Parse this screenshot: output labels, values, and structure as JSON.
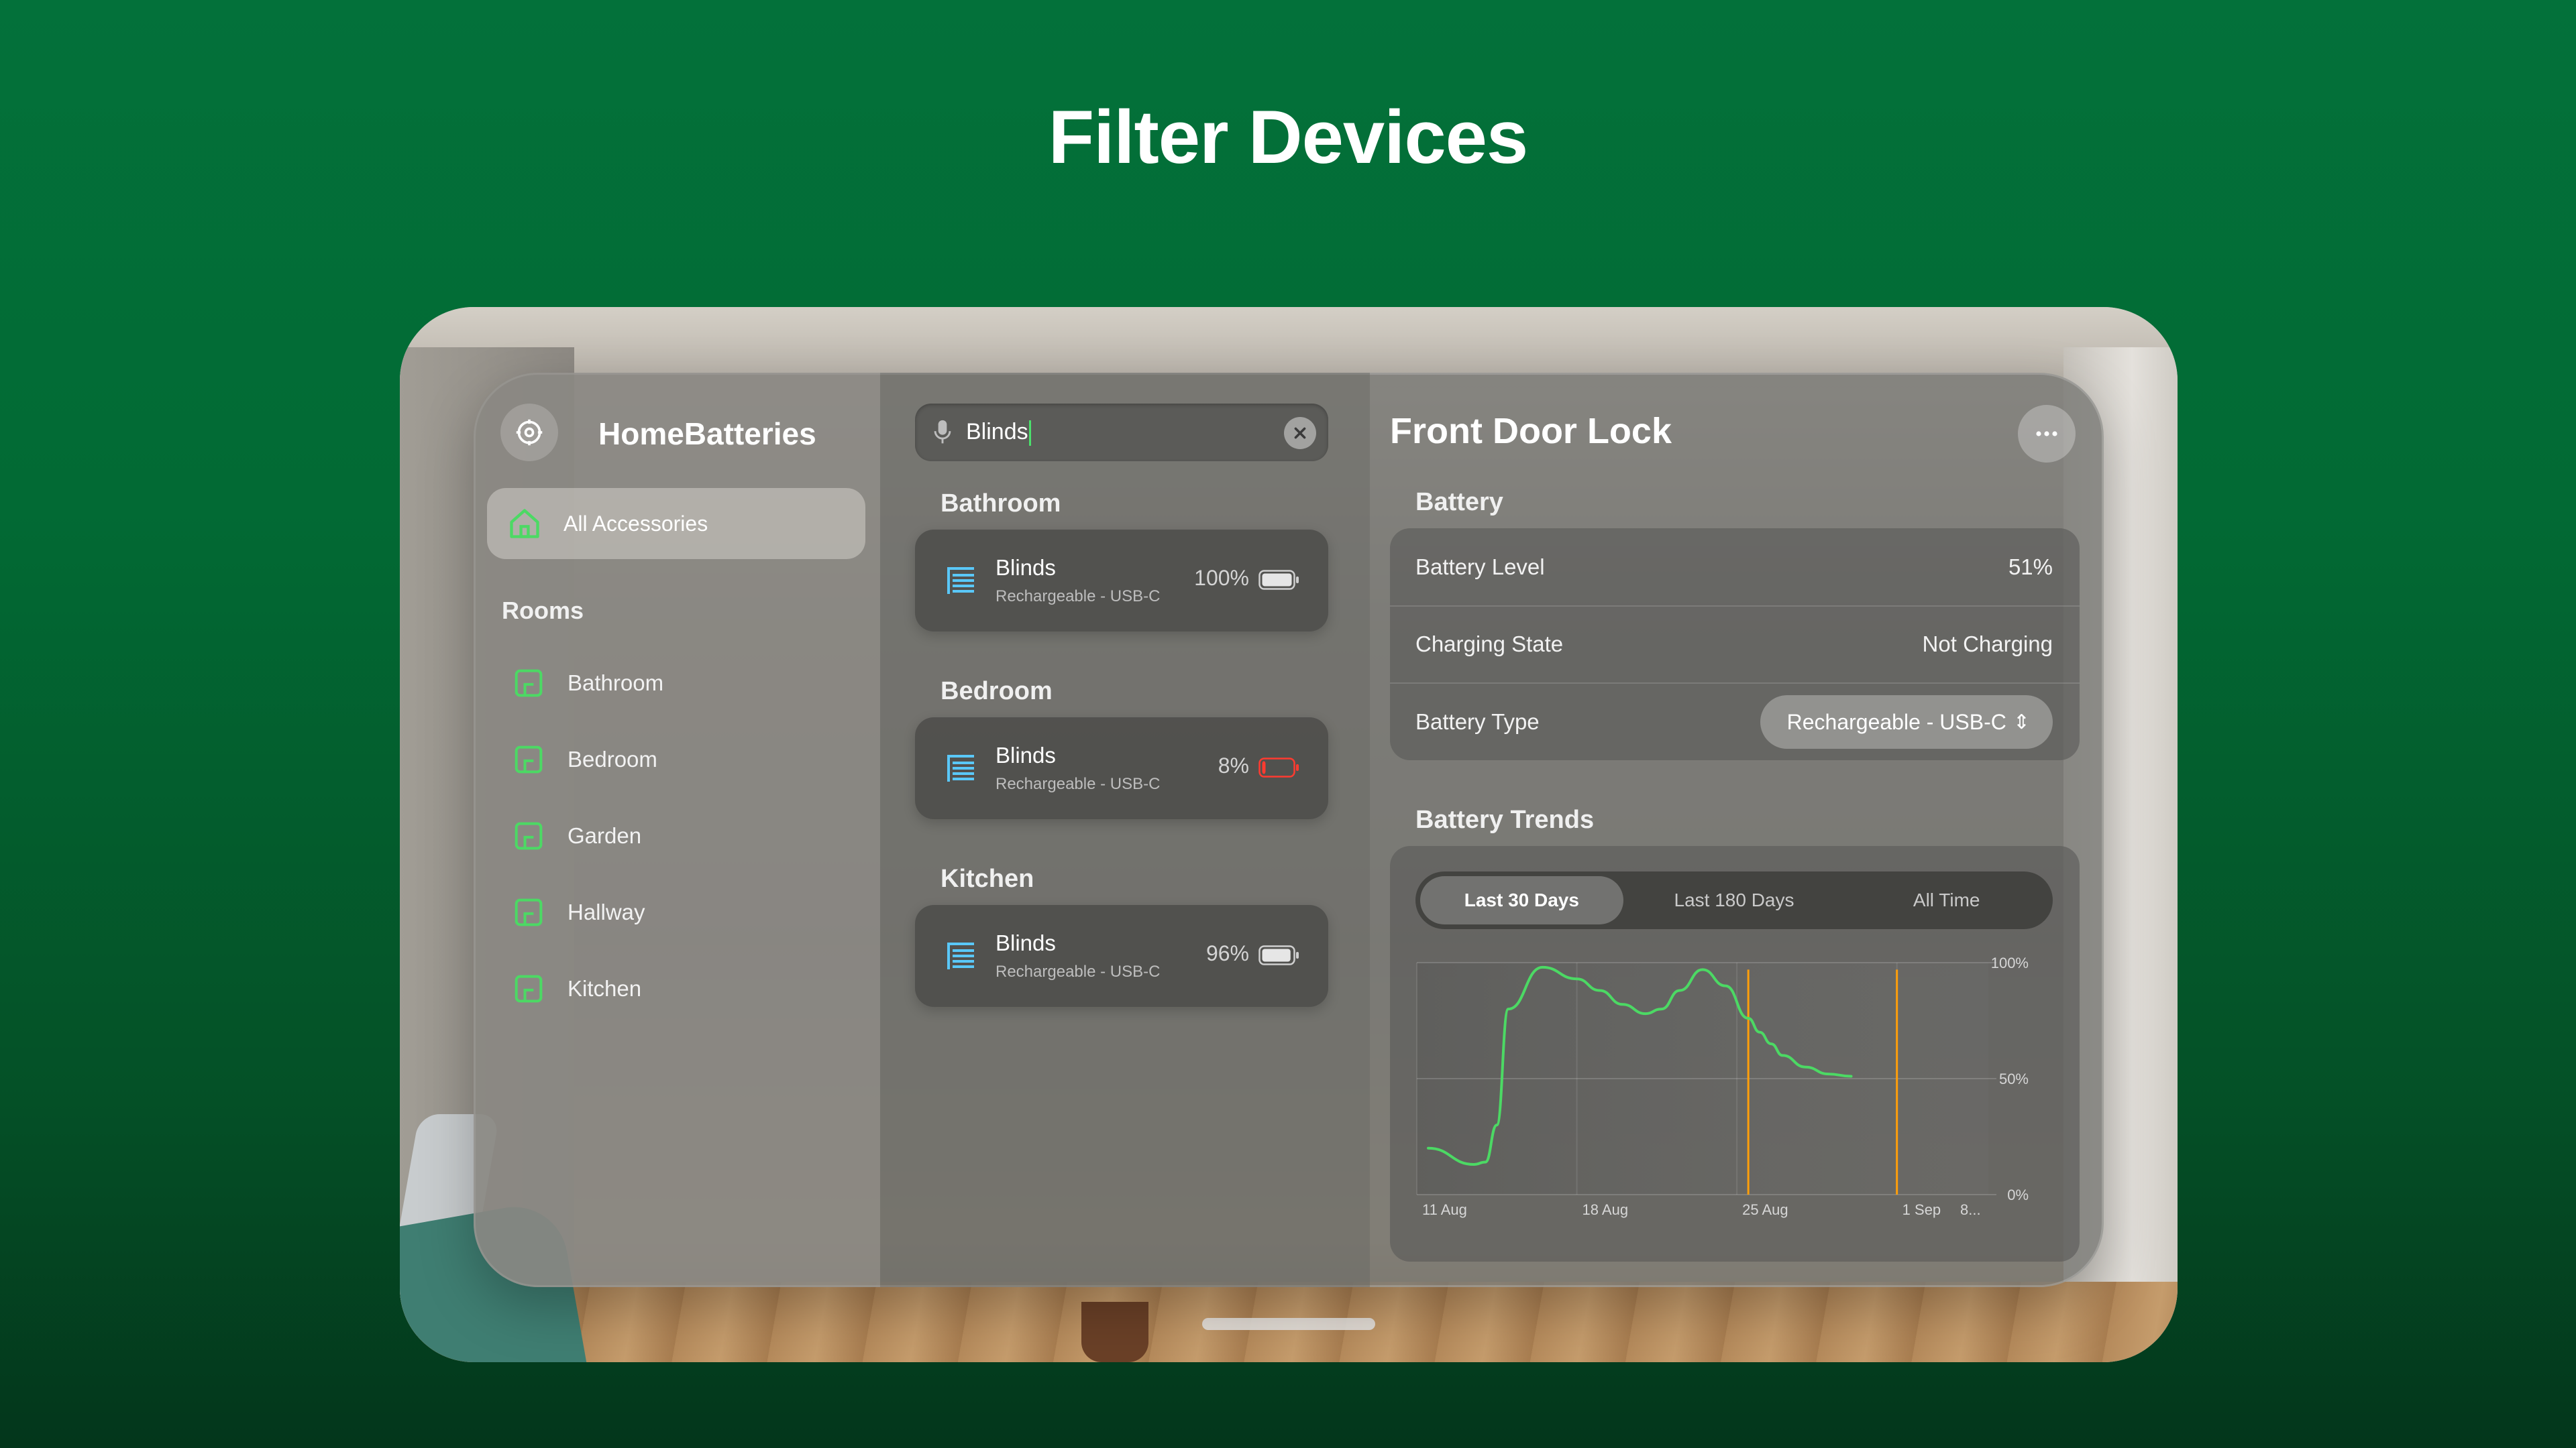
{
  "promo_title": "Filter Devices",
  "app": {
    "title": "HomeBatteries",
    "all_accessories": "All Accessories",
    "rooms_heading": "Rooms",
    "rooms": [
      "Bathroom",
      "Bedroom",
      "Garden",
      "Hallway",
      "Kitchen"
    ]
  },
  "search": {
    "value": "Blinds"
  },
  "groups": [
    {
      "heading": "Bathroom",
      "device": {
        "name": "Blinds",
        "type": "Rechargeable - USB-C",
        "percent": "100%",
        "level": 1.0,
        "status_color": "#e6e6e6"
      }
    },
    {
      "heading": "Bedroom",
      "device": {
        "name": "Blinds",
        "type": "Rechargeable - USB-C",
        "percent": "8%",
        "level": 0.08,
        "status_color": "#ff3b30"
      }
    },
    {
      "heading": "Kitchen",
      "device": {
        "name": "Blinds",
        "type": "Rechargeable - USB-C",
        "percent": "96%",
        "level": 0.96,
        "status_color": "#e6e6e6"
      }
    }
  ],
  "detail": {
    "title": "Front Door Lock",
    "battery_heading": "Battery",
    "rows": [
      {
        "key": "Battery Level",
        "value": "51%"
      },
      {
        "key": "Charging State",
        "value": "Not Charging"
      },
      {
        "key": "Battery Type",
        "value": "Rechargeable - USB-C"
      }
    ],
    "trends_heading": "Battery Trends",
    "ranges": [
      "Last 30 Days",
      "Last 180 Days",
      "All Time"
    ],
    "active_range": "Last 30 Days"
  },
  "colors": {
    "accent_green": "#4cd964",
    "device_blue": "#5ac8fa",
    "trend_line": "#4cd964",
    "charge_marker": "#ff9f0a"
  },
  "chart_data": {
    "type": "line",
    "x_tick_labels": [
      "11 Aug",
      "18 Aug",
      "25 Aug",
      "1 Sep",
      "8..."
    ],
    "y_tick_labels": [
      "100%",
      "50%",
      "0%"
    ],
    "ylim": [
      0,
      100
    ],
    "grid": true,
    "series": [
      {
        "x": [
          12.5,
          14.5,
          15.0,
          15.5,
          16.0,
          17.5,
          19.0,
          20.0,
          21.0,
          22.0,
          22.7,
          23.5,
          24.5,
          25.5,
          26.5,
          27.0,
          27.5,
          28.0,
          29.0,
          30.0,
          31.0
        ],
        "y": [
          20,
          13,
          14,
          30,
          80,
          98,
          93,
          88,
          82,
          78,
          80,
          88,
          97,
          90,
          76,
          70,
          65,
          60,
          55,
          52,
          51
        ]
      }
    ],
    "charge_markers": [
      "25 Aug",
      "4 Sep"
    ]
  }
}
